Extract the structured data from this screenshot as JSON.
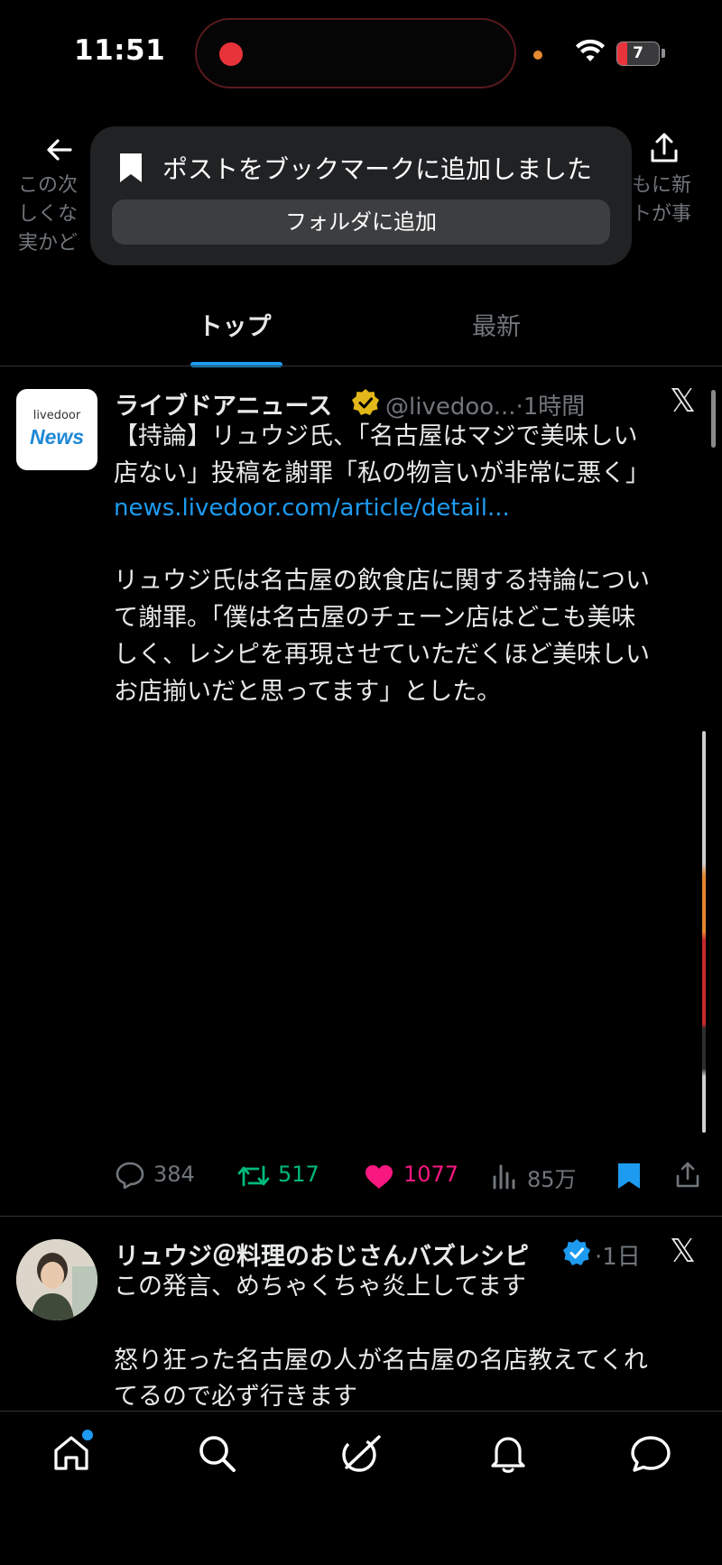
{
  "status_bar": {
    "time": "11:51",
    "battery": "7"
  },
  "background_text": {
    "line1_left": "この次",
    "line1_right": "もに新",
    "line2_left": "しくな",
    "line2_right": "トが事",
    "line3_left": "実かど"
  },
  "toast": {
    "message": "ポストをブックマークに追加しました",
    "button": "フォルダに追加"
  },
  "tabs": [
    {
      "label": "トップ",
      "active": true
    },
    {
      "label": "最新",
      "active": false
    }
  ],
  "post1": {
    "avatar_small": "livedoor",
    "avatar_big": "News",
    "name": "ライブドアニュース",
    "handle": "@livedoo...",
    "time": "·1時間",
    "text_line1": "【持論】リュウジ氏、「名古屋はマジで美味しい",
    "text_line2": "店ない」投稿を謝罪「私の物言いが非常に悪く」",
    "link": "news.livedoor.com/article/detail...",
    "body_line1": "リュウジ氏は名古屋の飲食店に関する持論につい",
    "body_line2": "て謝罪。「僕は名古屋のチェーン店はどこも美味",
    "body_line3": "しく、レシピを再現させていただくほど美味しい",
    "body_line4": "お店揃いだと思ってます」とした。",
    "replies": "384",
    "reposts": "517",
    "likes": "1077",
    "views": "85万"
  },
  "post2": {
    "name": "リュウジ＠料理のおじさんバズレシピ",
    "time": "·1日",
    "line1": "この発言、めちゃくちゃ炎上してます",
    "line2": "怒り狂った名古屋の人が名古屋の名店教えてくれ",
    "line3": "てるので必ず行きます"
  },
  "logo": "𝕏",
  "colors": {
    "accent": "#1d9bf0",
    "repost": "#00ba7c",
    "like": "#f91880",
    "gold": "#e2b719"
  }
}
